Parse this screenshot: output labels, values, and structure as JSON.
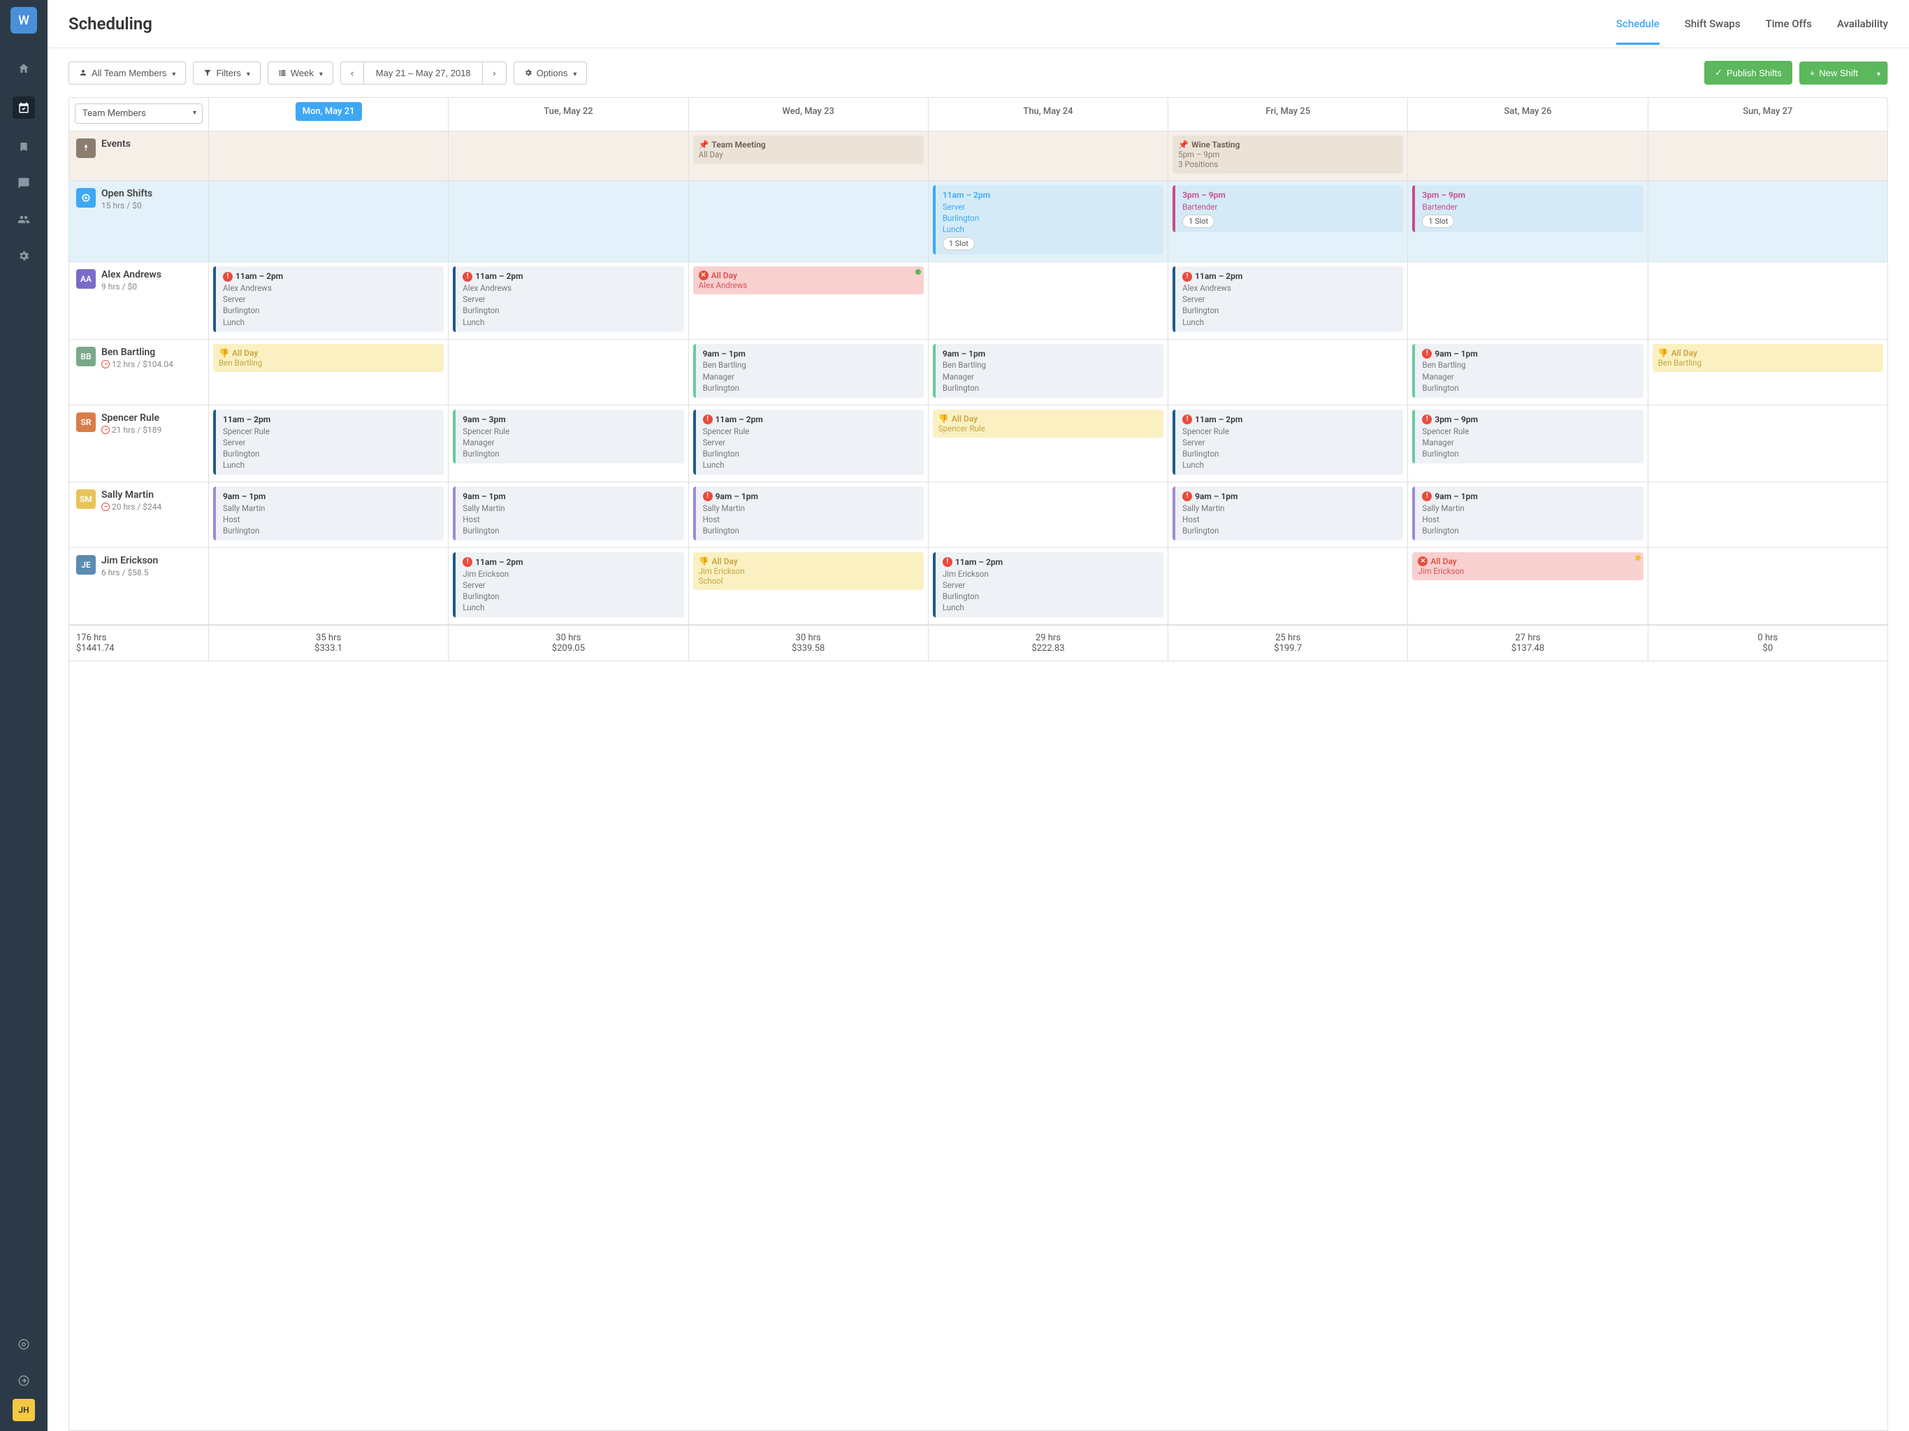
{
  "sidebar": {
    "logo": "W",
    "avatar": "JH"
  },
  "header": {
    "title": "Scheduling",
    "tabs": [
      "Schedule",
      "Shift Swaps",
      "Time Offs",
      "Availability"
    ]
  },
  "toolbar": {
    "team_members": "All Team Members",
    "filters": "Filters",
    "view": "Week",
    "date_range": "May 21 – May 27, 2018",
    "options": "Options",
    "publish": "Publish Shifts",
    "new_shift": "New Shift"
  },
  "columns": {
    "team_members_label": "Team Members",
    "days": [
      "Mon, May 21",
      "Tue, May 22",
      "Wed, May 23",
      "Thu, May 24",
      "Fri, May 25",
      "Sat, May 26",
      "Sun, May 27"
    ]
  },
  "events_row": {
    "label": "Events",
    "items": [
      {
        "day": 2,
        "title": "Team Meeting",
        "sub": "All Day"
      },
      {
        "day": 4,
        "title": "Wine Tasting",
        "sub": "5pm – 9pm",
        "sub2": "3 Positions"
      }
    ]
  },
  "open_shifts_row": {
    "label": "Open Shifts",
    "sub": "15 hrs / $0",
    "items": [
      {
        "day": 3,
        "time": "11am – 2pm",
        "role": "Server",
        "loc": "Burlington",
        "meal": "Lunch",
        "slot": "1 Slot",
        "color": "#3da8f5"
      },
      {
        "day": 4,
        "time": "3pm – 9pm",
        "role": "Bartender",
        "slot": "1 Slot",
        "color": "#c94b8c"
      },
      {
        "day": 5,
        "time": "3pm – 9pm",
        "role": "Bartender",
        "slot": "1 Slot",
        "color": "#c94b8c"
      }
    ]
  },
  "members": [
    {
      "initials": "AA",
      "color": "#7b6bc9",
      "name": "Alex Andrews",
      "sub": "9 hrs / $0",
      "shifts": [
        {
          "day": 0,
          "time": "11am – 2pm",
          "lines": [
            "Alex Andrews",
            "Server",
            "Burlington",
            "Lunch"
          ],
          "bar": "#1e5a8e",
          "bg": "#eef1f5",
          "alert": true
        },
        {
          "day": 1,
          "time": "11am – 2pm",
          "lines": [
            "Alex Andrews",
            "Server",
            "Burlington",
            "Lunch"
          ],
          "bar": "#1e5a8e",
          "bg": "#eef1f5",
          "alert": true
        },
        {
          "day": 2,
          "type": "allday",
          "title": "All Day",
          "sub": "Alex Andrews",
          "bg": "#f8d0d0",
          "tcolor": "#d9534f",
          "icon": "x",
          "dot": "green"
        },
        {
          "day": 4,
          "time": "11am – 2pm",
          "lines": [
            "Alex Andrews",
            "Server",
            "Burlington",
            "Lunch"
          ],
          "bar": "#1e5a8e",
          "bg": "#eef1f5",
          "alert": true
        }
      ]
    },
    {
      "initials": "BB",
      "color": "#7aa88a",
      "name": "Ben Bartling",
      "sub": "12 hrs / $104.04",
      "clock": true,
      "shifts": [
        {
          "day": 0,
          "type": "allday",
          "title": "All Day",
          "sub": "Ben Bartling",
          "bg": "#faf0c2",
          "tcolor": "#c9a53f",
          "icon": "thumb"
        },
        {
          "day": 2,
          "time": "9am – 1pm",
          "lines": [
            "Ben Bartling",
            "Manager",
            "Burlington"
          ],
          "bar": "#6bc9a3",
          "bg": "#eef1f5"
        },
        {
          "day": 3,
          "time": "9am – 1pm",
          "lines": [
            "Ben Bartling",
            "Manager",
            "Burlington"
          ],
          "bar": "#6bc9a3",
          "bg": "#eef1f5"
        },
        {
          "day": 5,
          "time": "9am – 1pm",
          "lines": [
            "Ben Bartling",
            "Manager",
            "Burlington"
          ],
          "bar": "#6bc9a3",
          "bg": "#eef1f5",
          "alert": true
        },
        {
          "day": 6,
          "type": "allday",
          "title": "All Day",
          "sub": "Ben Bartling",
          "bg": "#faf0c2",
          "tcolor": "#c9a53f",
          "icon": "thumb"
        }
      ]
    },
    {
      "initials": "SR",
      "color": "#d97d4a",
      "name": "Spencer Rule",
      "sub": "21 hrs / $189",
      "clock": true,
      "shifts": [
        {
          "day": 0,
          "time": "11am – 2pm",
          "lines": [
            "Spencer Rule",
            "Server",
            "Burlington",
            "Lunch"
          ],
          "bar": "#1e5a8e",
          "bg": "#eef1f5"
        },
        {
          "day": 1,
          "time": "9am – 3pm",
          "lines": [
            "Spencer Rule",
            "Manager",
            "Burlington"
          ],
          "bar": "#6bc9a3",
          "bg": "#eef1f5"
        },
        {
          "day": 2,
          "time": "11am – 2pm",
          "lines": [
            "Spencer Rule",
            "Server",
            "Burlington",
            "Lunch"
          ],
          "bar": "#1e5a8e",
          "bg": "#eef1f5",
          "alert": true
        },
        {
          "day": 3,
          "type": "allday",
          "title": "All Day",
          "sub": "Spencer Rule",
          "bg": "#faf0c2",
          "tcolor": "#c9a53f",
          "icon": "thumb"
        },
        {
          "day": 4,
          "time": "11am – 2pm",
          "lines": [
            "Spencer Rule",
            "Server",
            "Burlington",
            "Lunch"
          ],
          "bar": "#1e5a8e",
          "bg": "#eef1f5",
          "alert": true
        },
        {
          "day": 5,
          "time": "3pm – 9pm",
          "lines": [
            "Spencer Rule",
            "Manager",
            "Burlington"
          ],
          "bar": "#6bc9a3",
          "bg": "#eef1f5",
          "alert": true
        }
      ]
    },
    {
      "initials": "SM",
      "color": "#e8c35a",
      "name": "Sally Martin",
      "sub": "20 hrs / $244",
      "clock": true,
      "shifts": [
        {
          "day": 0,
          "time": "9am – 1pm",
          "lines": [
            "Sally Martin",
            "Host",
            "Burlington"
          ],
          "bar": "#9b8bd9",
          "bg": "#eef1f5"
        },
        {
          "day": 1,
          "time": "9am – 1pm",
          "lines": [
            "Sally Martin",
            "Host",
            "Burlington"
          ],
          "bar": "#9b8bd9",
          "bg": "#eef1f5"
        },
        {
          "day": 2,
          "time": "9am – 1pm",
          "lines": [
            "Sally Martin",
            "Host",
            "Burlington"
          ],
          "bar": "#9b8bd9",
          "bg": "#eef1f5",
          "alert": true
        },
        {
          "day": 4,
          "time": "9am – 1pm",
          "lines": [
            "Sally Martin",
            "Host",
            "Burlington"
          ],
          "bar": "#9b8bd9",
          "bg": "#eef1f5",
          "alert": true
        },
        {
          "day": 5,
          "time": "9am – 1pm",
          "lines": [
            "Sally Martin",
            "Host",
            "Burlington"
          ],
          "bar": "#9b8bd9",
          "bg": "#eef1f5",
          "alert": true
        }
      ]
    },
    {
      "initials": "JE",
      "color": "#5a8bb0",
      "name": "Jim Erickson",
      "sub": "6 hrs / $58.5",
      "shifts": [
        {
          "day": 1,
          "time": "11am – 2pm",
          "lines": [
            "Jim Erickson",
            "Server",
            "Burlington",
            "Lunch"
          ],
          "bar": "#1e5a8e",
          "bg": "#eef1f5",
          "alert": true
        },
        {
          "day": 2,
          "type": "allday",
          "title": "All Day",
          "sub": "Jim Erickson",
          "sub2": "School",
          "bg": "#faf0c2",
          "tcolor": "#c9a53f",
          "icon": "thumb"
        },
        {
          "day": 3,
          "time": "11am – 2pm",
          "lines": [
            "Jim Erickson",
            "Server",
            "Burlington",
            "Lunch"
          ],
          "bar": "#1e5a8e",
          "bg": "#eef1f5",
          "alert": true
        },
        {
          "day": 5,
          "type": "allday",
          "title": "All Day",
          "sub": "Jim Erickson",
          "bg": "#f8d0d0",
          "tcolor": "#d9534f",
          "icon": "x",
          "dot": "yellow"
        }
      ]
    }
  ],
  "footer": {
    "total_hrs": "176 hrs",
    "total_cost": "$1441.74",
    "days": [
      {
        "hrs": "35 hrs",
        "cost": "$333.1"
      },
      {
        "hrs": "30 hrs",
        "cost": "$209.05"
      },
      {
        "hrs": "30 hrs",
        "cost": "$339.58"
      },
      {
        "hrs": "29 hrs",
        "cost": "$222.83"
      },
      {
        "hrs": "25 hrs",
        "cost": "$199.7"
      },
      {
        "hrs": "27 hrs",
        "cost": "$137.48"
      },
      {
        "hrs": "0 hrs",
        "cost": "$0"
      }
    ]
  }
}
